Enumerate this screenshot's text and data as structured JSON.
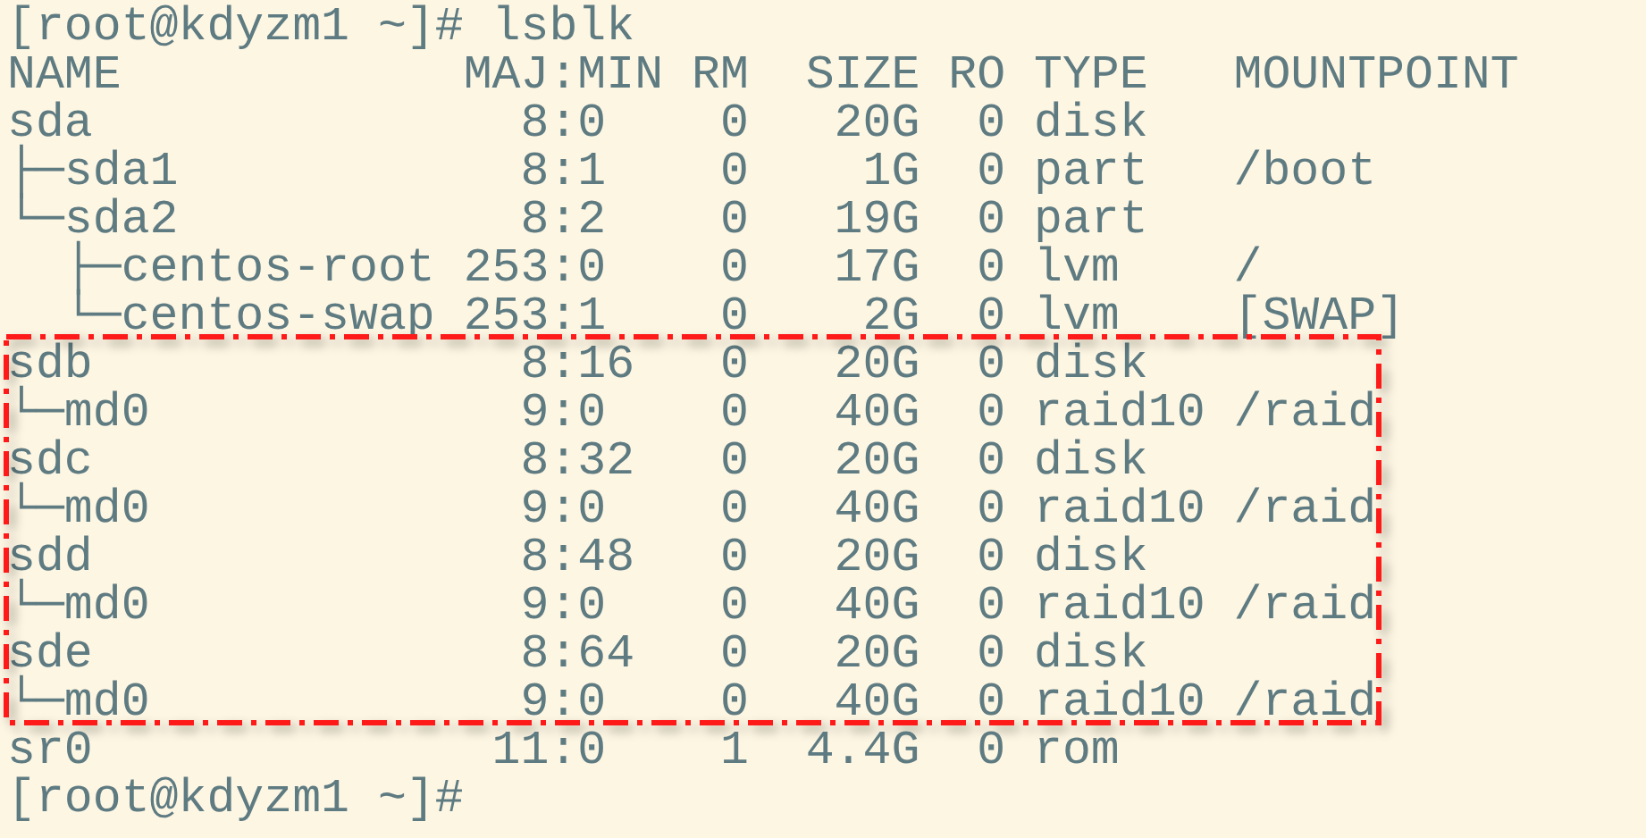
{
  "terminal": {
    "blocks": [
      {
        "highlighted": false,
        "lines": [
          "[root@kdyzm1 ~]# lsblk",
          "NAME            MAJ:MIN RM  SIZE RO TYPE   MOUNTPOINT",
          "sda               8:0    0   20G  0 disk",
          "├─sda1            8:1    0    1G  0 part   /boot",
          "└─sda2            8:2    0   19G  0 part",
          "  ├─centos-root 253:0    0   17G  0 lvm    /",
          "  └─centos-swap 253:1    0    2G  0 lvm    [SWAP]"
        ]
      },
      {
        "highlighted": true,
        "lines": [
          "sdb               8:16   0   20G  0 disk",
          "└─md0             9:0    0   40G  0 raid10 /raid",
          "sdc               8:32   0   20G  0 disk",
          "└─md0             9:0    0   40G  0 raid10 /raid",
          "sdd               8:48   0   20G  0 disk",
          "└─md0             9:0    0   40G  0 raid10 /raid",
          "sde               8:64   0   20G  0 disk",
          "└─md0             9:0    0   40G  0 raid10 /raid"
        ]
      },
      {
        "highlighted": false,
        "lines": [
          "sr0              11:0    1  4.4G  0 rom",
          "[root@kdyzm1 ~]#"
        ]
      }
    ]
  }
}
